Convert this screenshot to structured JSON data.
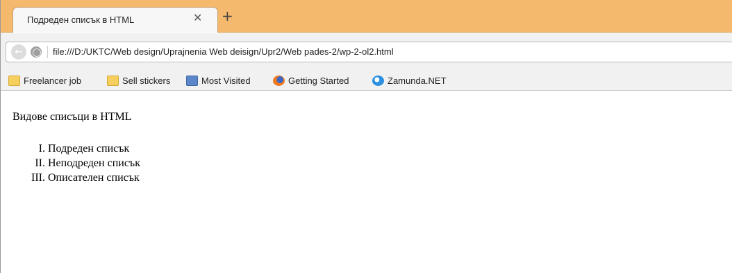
{
  "browser": {
    "tab": {
      "title": "Подреден списък в HTML",
      "close_glyph": "✕"
    },
    "new_tab_glyph": "+",
    "address_bar": {
      "url": "file:///D:/UKTC/Web design/Uprajnenia Web deisign/Upr2/Web pades-2/wp-2-ol2.html"
    },
    "bookmarks": [
      {
        "label": "Freelancer job",
        "icon": "folder-icon"
      },
      {
        "label": "Sell stickers",
        "icon": "folder-icon"
      },
      {
        "label": "Most Visited",
        "icon": "most-visited-icon"
      },
      {
        "label": "Getting Started",
        "icon": "firefox-icon"
      },
      {
        "label": "Zamunda.NET",
        "icon": "zamunda-icon"
      }
    ],
    "colors": {
      "tabstrip": "#f4b96c",
      "toolbar": "#f1f1f1"
    }
  },
  "page": {
    "heading": "Видове списъци в HTML",
    "list": [
      {
        "marker": "I.",
        "text": "Подреден списък"
      },
      {
        "marker": "II.",
        "text": "Неподреден списък"
      },
      {
        "marker": "III.",
        "text": "Описателен списък"
      }
    ]
  }
}
